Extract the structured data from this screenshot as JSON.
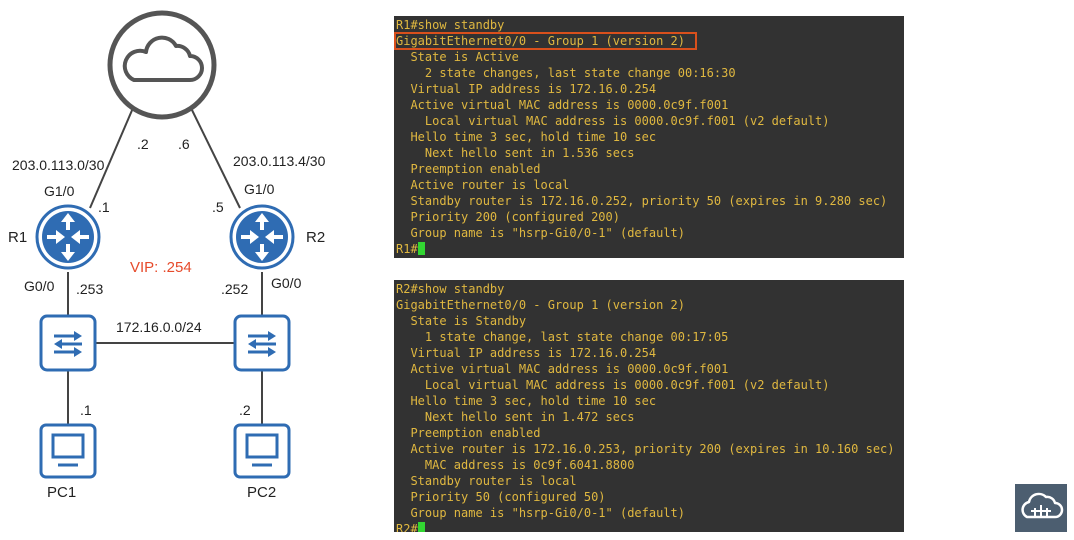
{
  "diagram": {
    "left_wan_subnet": "203.0.113.0/30",
    "right_wan_subnet": "203.0.113.4/30",
    "isp_left_ip": ".2",
    "isp_right_ip": ".6",
    "r1_wan_iface": "G1/0",
    "r1_wan_ip": ".1",
    "r2_wan_iface": "G1/0",
    "r2_wan_ip": ".5",
    "r1_name": "R1",
    "r2_name": "R2",
    "vip": "VIP: .254",
    "r1_lan_iface": "G0/0",
    "r1_lan_ip": ".253",
    "r2_lan_ip": ".252",
    "r2_lan_iface": "G0/0",
    "lan_subnet": "172.16.0.0/24",
    "pc1_ip": ".1",
    "pc2_ip": ".2",
    "pc1_name": "PC1",
    "pc2_name": "PC2"
  },
  "terminal_r1": {
    "lines": [
      "R1#show standby",
      "GigabitEthernet0/0 - Group 1 (version 2)",
      "  State is Active",
      "    2 state changes, last state change 00:16:30",
      "  Virtual IP address is 172.16.0.254",
      "  Active virtual MAC address is 0000.0c9f.f001",
      "    Local virtual MAC address is 0000.0c9f.f001 (v2 default)",
      "  Hello time 3 sec, hold time 10 sec",
      "    Next hello sent in 1.536 secs",
      "  Preemption enabled",
      "  Active router is local",
      "  Standby router is 172.16.0.252, priority 50 (expires in 9.280 sec)",
      "  Priority 200 (configured 200)",
      "  Group name is \"hsrp-Gi0/0-1\" (default)"
    ],
    "prompt": "R1#"
  },
  "terminal_r2": {
    "lines": [
      "R2#show standby",
      "GigabitEthernet0/0 - Group 1 (version 2)",
      "  State is Standby",
      "    1 state change, last state change 00:17:05",
      "  Virtual IP address is 172.16.0.254",
      "  Active virtual MAC address is 0000.0c9f.f001",
      "    Local virtual MAC address is 0000.0c9f.f001 (v2 default)",
      "  Hello time 3 sec, hold time 10 sec",
      "    Next hello sent in 1.472 secs",
      "  Preemption enabled",
      "  Active router is 172.16.0.253, priority 200 (expires in 10.160 sec)",
      "    MAC address is 0c9f.6041.8800",
      "  Standby router is local",
      "  Priority 50 (configured 50)",
      "  Group name is \"hsrp-Gi0/0-1\" (default)"
    ],
    "prompt": "R2#"
  },
  "colors": {
    "device_blue": "#2f6cb3",
    "terminal_bg": "#323232",
    "terminal_text": "#e0b840",
    "highlight": "#d9501c",
    "vip_text": "#e64b2b",
    "cursor": "#32d632"
  },
  "icons": [
    "cloud-icon",
    "router-icon",
    "switch-icon",
    "pc-icon",
    "cloud-logo-icon"
  ]
}
